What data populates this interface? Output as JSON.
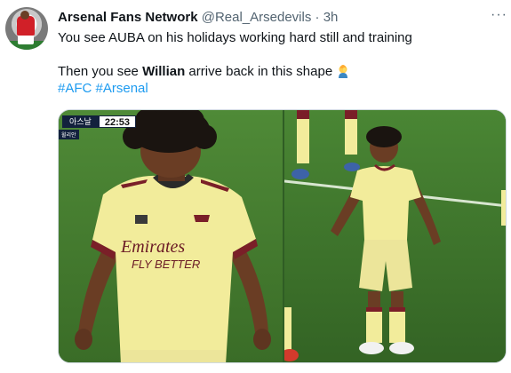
{
  "tweet": {
    "display_name": "Arsenal Fans Network",
    "handle": "@Real_Arsedevils",
    "separator": "·",
    "time": "3h",
    "more_icon": "more-horizontal-icon",
    "line1": "You see AUBA on his holidays working hard still and training",
    "line2_before": "Then you see ",
    "line2_bold": "Willian",
    "line2_after": " arrive back in this shape ",
    "emoji": "facepalm-emoji",
    "hashtag1": "#AFC",
    "hashtag2": "#Arsenal"
  },
  "media": {
    "scoreboard_team": "아스날",
    "scoreboard_clock": "22:53",
    "scoreboard_sub": "윌리안",
    "sponsor_line1": "Emirates",
    "sponsor_line2": "FLY BETTER"
  },
  "colors": {
    "link": "#1d9bf0",
    "secondary_text": "#536471",
    "kit_yellow": "#f3ee9c",
    "pitch_green": "#3f7a2f"
  }
}
